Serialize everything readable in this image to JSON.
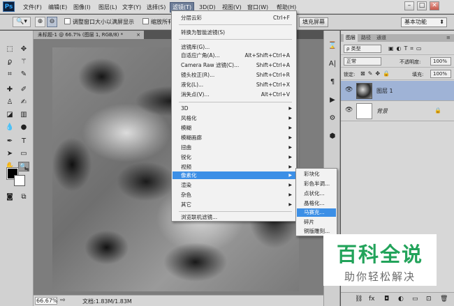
{
  "app_logo": "Ps",
  "menubar": {
    "items": [
      "文件(F)",
      "编辑(E)",
      "图像(I)",
      "图层(L)",
      "文字(Y)",
      "选择(S)",
      "滤镜(T)",
      "3D(D)",
      "视图(V)",
      "窗口(W)",
      "帮助(H)"
    ],
    "active": "滤镜(T)"
  },
  "window_controls": {
    "minimize": "–",
    "restore": "□",
    "close": "✕"
  },
  "options_bar": {
    "checkbox_resize": "调整窗口大小以满屏显示",
    "checkbox_all": "缩放所有窗口",
    "fill_screen_button": "填充屏幕",
    "workspace": "基本功能"
  },
  "document_tab": {
    "title": "未标题-1 @ 66.7% (图层 1, RGB/8) *",
    "close": "×"
  },
  "status_bar": {
    "zoom": "66.67%",
    "doc_info": "文档:1.83M/1.83M"
  },
  "filter_menu": {
    "items": [
      {
        "label": "分层云彩",
        "shortcut": "Ctrl+F"
      },
      {
        "label": "转换为智能滤镜(S)",
        "shortcut": ""
      },
      {
        "label": "滤镜库(G)...",
        "shortcut": ""
      },
      {
        "label": "自适应广角(A)...",
        "shortcut": "Alt+Shift+Ctrl+A"
      },
      {
        "label": "Camera Raw 滤镜(C)...",
        "shortcut": "Shift+Ctrl+A"
      },
      {
        "label": "镜头校正(R)...",
        "shortcut": "Shift+Ctrl+R"
      },
      {
        "label": "液化(L)...",
        "shortcut": "Shift+Ctrl+X"
      },
      {
        "label": "消失点(V)...",
        "shortcut": "Alt+Ctrl+V"
      },
      {
        "label": "3D",
        "shortcut": ""
      },
      {
        "label": "风格化",
        "shortcut": ""
      },
      {
        "label": "模糊",
        "shortcut": ""
      },
      {
        "label": "模糊画廊",
        "shortcut": ""
      },
      {
        "label": "扭曲",
        "shortcut": ""
      },
      {
        "label": "锐化",
        "shortcut": ""
      },
      {
        "label": "视频",
        "shortcut": ""
      },
      {
        "label": "像素化",
        "shortcut": ""
      },
      {
        "label": "渲染",
        "shortcut": ""
      },
      {
        "label": "杂色",
        "shortcut": ""
      },
      {
        "label": "其它",
        "shortcut": ""
      },
      {
        "label": "浏览联机滤镜...",
        "shortcut": ""
      }
    ],
    "highlighted": "像素化"
  },
  "pixelate_submenu": {
    "items": [
      "彩块化",
      "彩色半调...",
      "点状化...",
      "晶格化...",
      "马赛克...",
      "碎片",
      "铜版雕刻..."
    ],
    "highlighted": "马赛克..."
  },
  "layers_panel": {
    "tabs": [
      "图层",
      "路径",
      "通道"
    ],
    "kind_filter": "ρ 类型",
    "blend_mode": "正常",
    "opacity_label": "不透明度:",
    "opacity": "100%",
    "lock_label": "锁定:",
    "fill_label": "填充:",
    "fill": "100%",
    "layers": [
      {
        "name": "图层 1",
        "selected": true
      },
      {
        "name": "背景",
        "selected": false,
        "locked": true
      }
    ]
  },
  "watermark": {
    "title": "百科全说",
    "subtitle": "助你轻松解决"
  },
  "colors": {
    "menu_highlight": "#3c8fe6",
    "watermark_green": "#22a35a",
    "layer_selected": "#9fb3d6"
  }
}
